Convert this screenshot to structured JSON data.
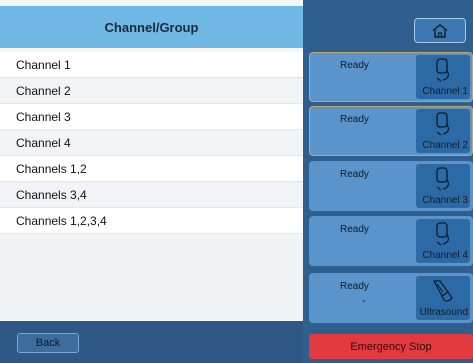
{
  "header": {
    "title": "Channel/Group"
  },
  "list": [
    {
      "label": "Channel 1"
    },
    {
      "label": "Channel 2"
    },
    {
      "label": "Channel 3"
    },
    {
      "label": "Channel 4"
    },
    {
      "label": "Channels 1,2"
    },
    {
      "label": "Channels 3,4"
    },
    {
      "label": "Channels 1,2,3,4"
    }
  ],
  "footer": {
    "back_label": "Back"
  },
  "right": {
    "home_icon": "home-icon",
    "cards": [
      {
        "status": "Ready",
        "label": "Channel 1",
        "icon": "probe-icon",
        "selected": true
      },
      {
        "status": "Ready",
        "label": "Channel 2",
        "icon": "probe-icon",
        "selected": true
      },
      {
        "status": "Ready",
        "label": "Channel 3",
        "icon": "probe-icon",
        "selected": false
      },
      {
        "status": "Ready",
        "label": "Channel 4",
        "icon": "probe-icon",
        "selected": false
      },
      {
        "status": "Ready",
        "extra": "-",
        "label": "Ultrasound",
        "icon": "ultrasound-probe-icon",
        "selected": false
      }
    ],
    "emergency_label": "Emergency Stop"
  },
  "colors": {
    "header": "#6fb8e6",
    "panel": "#2e5f8f",
    "card": "#5b93cb",
    "tile": "#2c6aa6",
    "selected_border": "#c6a36b",
    "emergency": "#e33a3f"
  }
}
